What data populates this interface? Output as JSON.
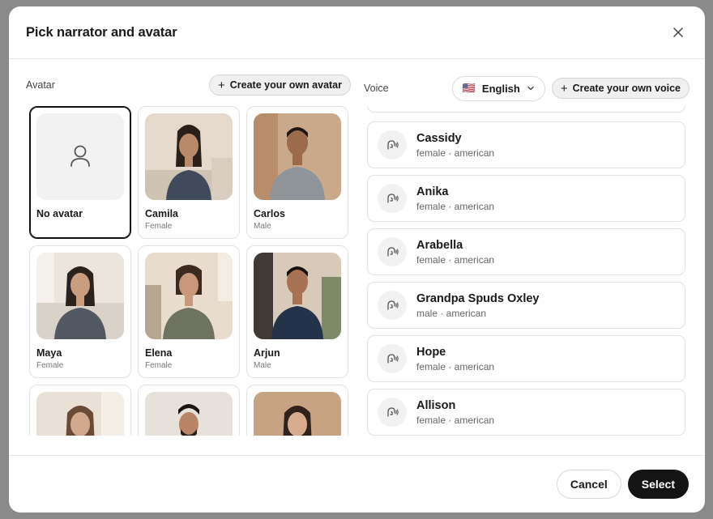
{
  "dialog": {
    "title": "Pick narrator and avatar",
    "close_icon": "close-icon"
  },
  "avatar_section": {
    "label": "Avatar",
    "create_label": "Create your own avatar",
    "items": [
      {
        "name": "No avatar",
        "gender": "",
        "selected": true,
        "icon": "user-icon"
      },
      {
        "name": "Camila",
        "gender": "Female"
      },
      {
        "name": "Carlos",
        "gender": "Male"
      },
      {
        "name": "Maya",
        "gender": "Female"
      },
      {
        "name": "Elena",
        "gender": "Female"
      },
      {
        "name": "Arjun",
        "gender": "Male"
      },
      {
        "name": "",
        "gender": ""
      },
      {
        "name": "",
        "gender": ""
      },
      {
        "name": "",
        "gender": ""
      }
    ]
  },
  "voice_section": {
    "label": "Voice",
    "language": {
      "flag": "🇺🇸",
      "label": "English"
    },
    "create_label": "Create your own voice",
    "items": [
      {
        "name": "Cassidy",
        "meta": "female · american"
      },
      {
        "name": "Anika",
        "meta": "female · american"
      },
      {
        "name": "Arabella",
        "meta": "female · american"
      },
      {
        "name": "Grandpa Spuds Oxley",
        "meta": "male · american"
      },
      {
        "name": "Hope",
        "meta": "female · american"
      },
      {
        "name": "Allison",
        "meta": "female · american"
      }
    ]
  },
  "footer": {
    "cancel_label": "Cancel",
    "select_label": "Select"
  }
}
